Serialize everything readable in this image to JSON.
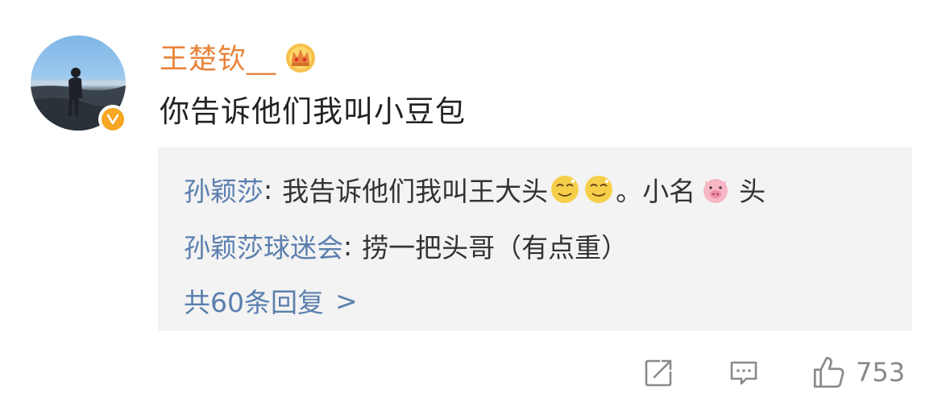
{
  "comment": {
    "username": "王楚钦__",
    "text": "你告诉他们我叫小豆包",
    "verified": true,
    "badge_icon": "crown-icon"
  },
  "replies": [
    {
      "author": "孙颖莎",
      "text_before": "我告诉他们我叫王大头",
      "emojis_mid": [
        "dizzy-face-emoji",
        "dizzy-face-emoji"
      ],
      "text_after": "。小名",
      "emoji_end": "pig-face-emoji",
      "text_end": "头"
    },
    {
      "author": "孙颖莎球迷会",
      "text": "捞一把头哥（有点重）"
    }
  ],
  "more_replies": {
    "label": "共60条回复",
    "arrow": ">"
  },
  "actions": {
    "like_count": "753"
  },
  "colors": {
    "username": "#e8833a",
    "reply_author": "#5b7fae",
    "reply_bg": "#f3f3f3",
    "badge": "#f5a623"
  }
}
